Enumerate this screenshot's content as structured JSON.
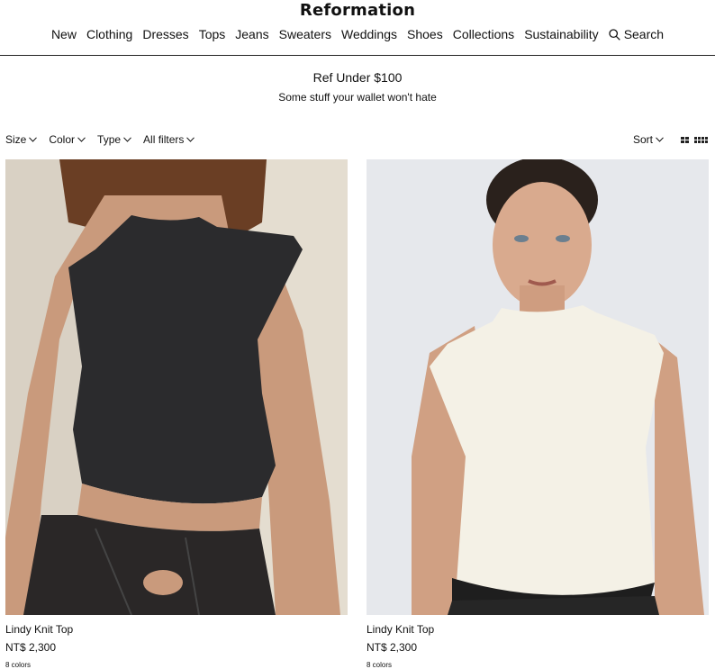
{
  "brand": "Reformation",
  "nav": {
    "items": [
      "New",
      "Clothing",
      "Dresses",
      "Tops",
      "Jeans",
      "Sweaters",
      "Weddings",
      "Shoes",
      "Collections",
      "Sustainability"
    ],
    "search_label": "Search"
  },
  "promo": {
    "title": "Ref Under $100",
    "subtitle": "Some stuff your wallet won't hate"
  },
  "filters": [
    "Size",
    "Color",
    "Type",
    "All filters"
  ],
  "sort_label": "Sort",
  "products": [
    {
      "name": "Lindy Knit Top",
      "price": "NT$ 2,300",
      "colors": "8 colors",
      "top_color": "#2b2b2d"
    },
    {
      "name": "Lindy Knit Top",
      "price": "NT$ 2,300",
      "colors": "8 colors",
      "top_color": "#f4f1e6"
    }
  ],
  "colors": {
    "accent": "#111111",
    "rule": "#222222"
  }
}
